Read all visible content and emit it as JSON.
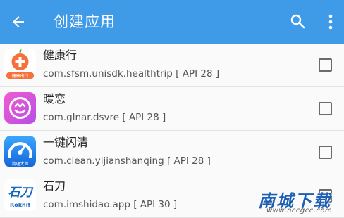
{
  "colors": {
    "appbar": "#3f9be8",
    "text_primary": "#222222",
    "text_secondary": "#555555",
    "checkbox": "#6b6b6b"
  },
  "appbar": {
    "title": "创建应用",
    "back_icon": "arrow-back-icon",
    "search_icon": "search-icon",
    "more_icon": "more-vert-icon"
  },
  "apps": [
    {
      "name": "健康行",
      "package": "com.sfsm.unisdk.healthtrip [ API 28 ]",
      "icon_label": "健康出行",
      "checked": false
    },
    {
      "name": "暖恋",
      "package": "com.glnar.dsvre [ API 28 ]",
      "icon_label": "",
      "checked": false
    },
    {
      "name": "一键闪清",
      "package": "com.clean.yijianshanqing [ API 28 ]",
      "icon_label": "清理大师",
      "checked": false
    },
    {
      "name": "石刀",
      "package": "com.imshidao.app [ API 30 ]",
      "icon_label": "Roknif",
      "checked": false
    }
  ],
  "watermark": {
    "main": "南城下载",
    "url": "www.nccgcc.com"
  }
}
